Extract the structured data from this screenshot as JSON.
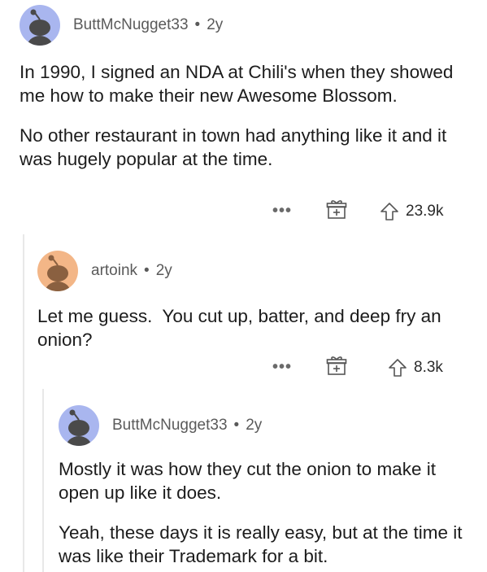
{
  "comments": [
    {
      "username": "ButtMcNugget33",
      "separator": "•",
      "age": "2y",
      "paragraphs": [
        "In 1990, I signed an NDA at Chili's when they showed me how to make their new Awesome Blossom.",
        "No other restaurant in town had anything like it and it was hugely popular at the time."
      ],
      "more_label": "•••",
      "votes": "23.9k",
      "avatar_color": "#a9b6ef",
      "icons": [
        "more-icon",
        "gift-icon",
        "upvote-icon"
      ]
    },
    {
      "username": "artoink",
      "separator": "•",
      "age": "2y",
      "paragraphs": [
        "Let me guess.  You cut up, batter, and deep fry an onion?"
      ],
      "more_label": "•••",
      "votes": "8.3k",
      "avatar_color": "#f3b687",
      "icons": [
        "more-icon",
        "gift-icon",
        "upvote-icon"
      ]
    },
    {
      "username": "ButtMcNugget33",
      "separator": "•",
      "age": "2y",
      "paragraphs": [
        "Mostly it was how they cut the onion to make it open up like it does.",
        "Yeah, these days it is really easy, but at the time it was like their Trademark for a bit."
      ],
      "avatar_color": "#a9b6ef"
    }
  ]
}
